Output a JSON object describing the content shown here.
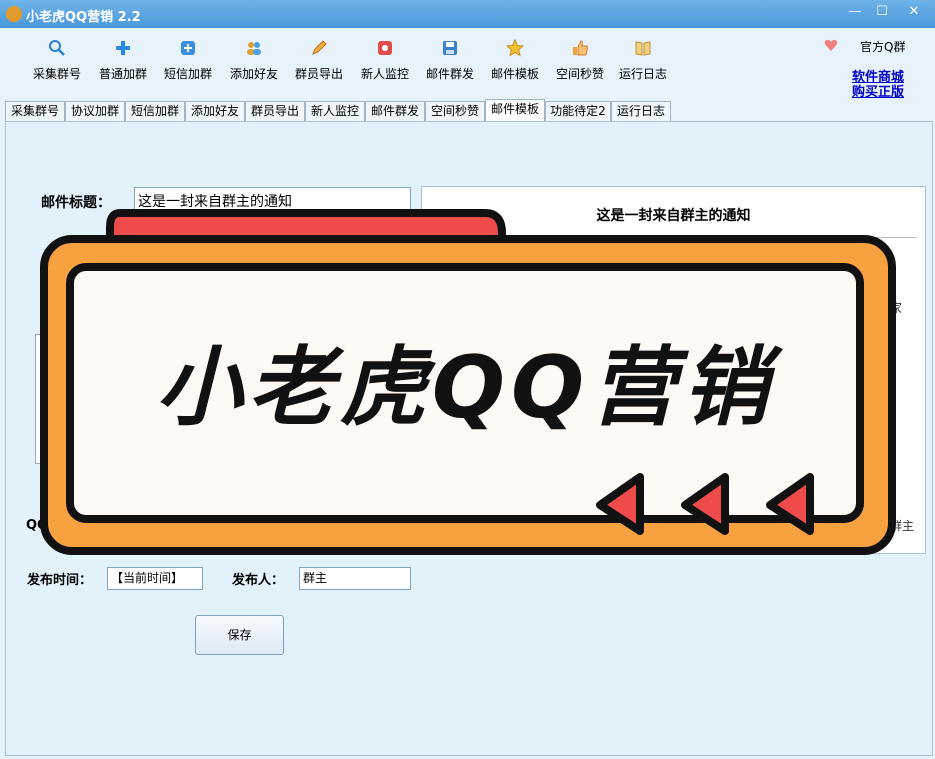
{
  "window": {
    "title": "小老虎QQ营销 2.2",
    "minimize": "—",
    "maximize": "☐",
    "close": "✕"
  },
  "toolbar": {
    "items": [
      {
        "label": "采集群号",
        "icon": "search-icon"
      },
      {
        "label": "普通加群",
        "icon": "plus-icon"
      },
      {
        "label": "短信加群",
        "icon": "plus-box-icon"
      },
      {
        "label": "添加好友",
        "icon": "users-icon"
      },
      {
        "label": "群员导出",
        "icon": "pencil-icon"
      },
      {
        "label": "新人监控",
        "icon": "record-icon"
      },
      {
        "label": "邮件群发",
        "icon": "save-icon"
      },
      {
        "label": "邮件模板",
        "icon": "star-icon"
      },
      {
        "label": "空间秒赞",
        "icon": "thumb-icon"
      },
      {
        "label": "运行日志",
        "icon": "book-icon"
      }
    ]
  },
  "right": {
    "qq_group": "官方Q群",
    "link_mall": "软件商城",
    "link_buy": "购买正版"
  },
  "tabs": [
    {
      "label": "采集群号"
    },
    {
      "label": "协议加群"
    },
    {
      "label": "短信加群"
    },
    {
      "label": "添加好友"
    },
    {
      "label": "群员导出"
    },
    {
      "label": "新人监控"
    },
    {
      "label": "邮件群发"
    },
    {
      "label": "空间秒赞"
    },
    {
      "label": "邮件模板",
      "active": true
    },
    {
      "label": "功能待定2"
    },
    {
      "label": "运行日志"
    }
  ],
  "form": {
    "subject_label": "邮件标题：",
    "subject_value": "这是一封来自群主的通知",
    "qq_label_partial": "QQ",
    "publish_time_label": "发布时间：",
    "publish_time_value": "【当前时间】",
    "publisher_label": "发布人：",
    "publisher_value": "群主",
    "save_label": "保存"
  },
  "preview": {
    "title": "这是一封来自群主的通知",
    "right_fragment_1": "家",
    "right_fragment_2": "群主"
  },
  "banner": {
    "text": "小老虎QQ营销"
  },
  "colors": {
    "accent": "#4b97d8",
    "banner_orange": "#f7a140",
    "banner_red": "#ef4b4b",
    "banner_black": "#111111"
  }
}
